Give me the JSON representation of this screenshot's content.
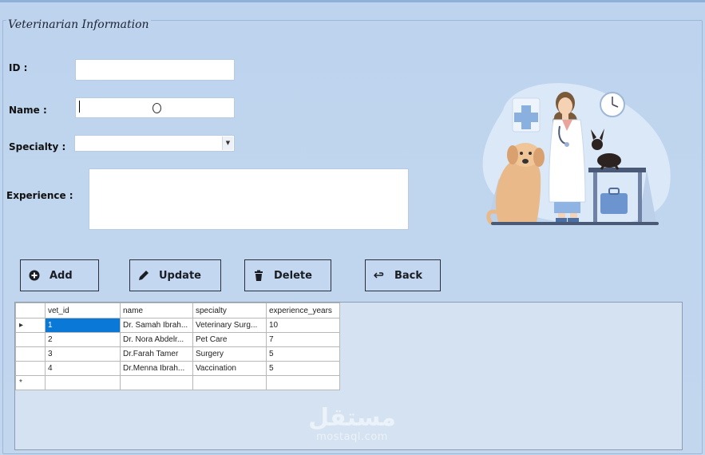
{
  "form": {
    "title": "Veterinarian Information",
    "labels": {
      "id": "ID :",
      "name": "Name :",
      "specialty": "Specialty :",
      "experience": "Experience :"
    },
    "values": {
      "id": "",
      "name": "",
      "specialty": "",
      "experience": ""
    }
  },
  "buttons": {
    "add": "Add",
    "update": "Update",
    "delete": "Delete",
    "back": "Back"
  },
  "grid": {
    "columns": [
      "vet_id",
      "name",
      "specialty",
      "experience_years"
    ],
    "rows": [
      {
        "vet_id": "1",
        "name": "Dr. Samah Ibrah...",
        "specialty": "Veterinary Surg...",
        "experience_years": "10",
        "current": true
      },
      {
        "vet_id": "2",
        "name": "Dr. Nora Abdelr...",
        "specialty": "Pet Care",
        "experience_years": "7"
      },
      {
        "vet_id": "3",
        "name": "Dr.Farah Tamer",
        "specialty": "Surgery",
        "experience_years": "5"
      },
      {
        "vet_id": "4",
        "name": "Dr.Menna Ibrah...",
        "specialty": "Vaccination",
        "experience_years": "5"
      }
    ],
    "current_row_marker": "▸",
    "new_row_marker": "*"
  },
  "watermark": {
    "arabic": "مستقل",
    "latin": "mostaql.com"
  },
  "colors": {
    "background": "#bed4ee",
    "button_fill": "#c3d8f0",
    "selection": "#0a78d7",
    "grid_background": "#d5e2f1"
  },
  "icons": {
    "add": "plus-circle-icon",
    "update": "pencil-icon",
    "delete": "trash-icon",
    "back": "return-arrow-icon"
  }
}
